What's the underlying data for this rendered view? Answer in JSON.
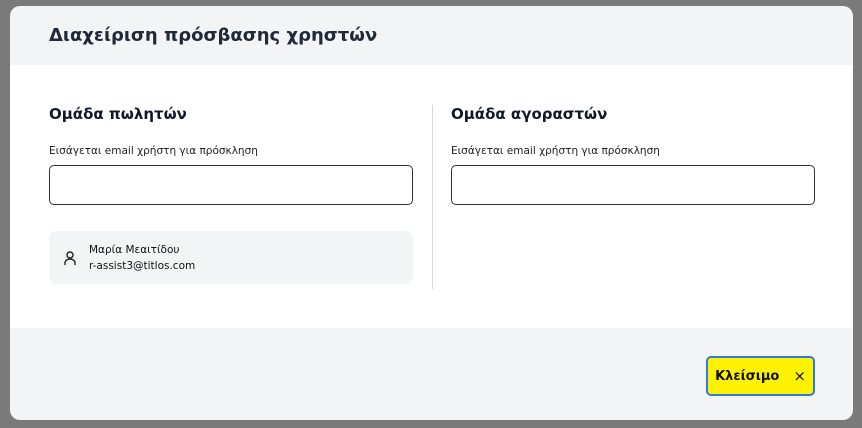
{
  "modal": {
    "title": "Διαχείριση πρόσβασης χρηστών",
    "sellers": {
      "heading": "Ομάδα πωλητών",
      "label": "Εισάγεται email χρήστη για πρόσκληση",
      "value": "",
      "users": [
        {
          "name": "Μαρία Μεαιτίδου",
          "email": "r-assist3@titlos.com",
          "icon": "user-icon"
        }
      ]
    },
    "buyers": {
      "heading": "Ομάδα αγοραστών",
      "label": "Εισάγεται email χρήστη για πρόσκληση",
      "value": ""
    },
    "close_label": "Κλείσιμο",
    "close_icon": "×"
  },
  "colors": {
    "accent": "#fff200",
    "focus": "#2f7bdc"
  }
}
